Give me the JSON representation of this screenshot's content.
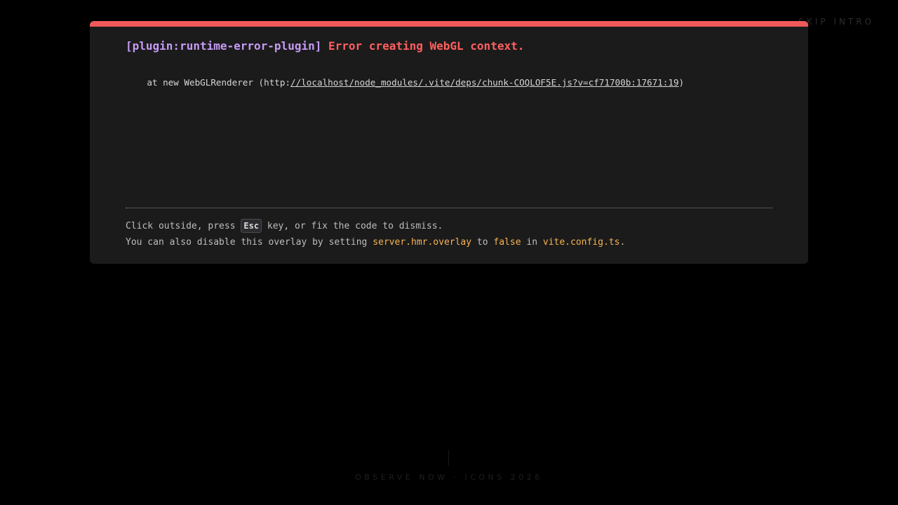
{
  "background": {
    "skip_intro": "SKIP INTRO",
    "footer": "OBSERVE NOW · ICONS 2026"
  },
  "overlay": {
    "accent_color": "#f0595a",
    "plugin": "[plugin:runtime-error-plugin]",
    "message": "Error creating WebGL context.",
    "stack_prefix": "    at new WebGLRenderer (http:",
    "stack_link": "//localhost/node_modules/.vite/deps/chunk-COQLOF5E.js?v=cf71700b:17671:19",
    "stack_suffix": ")",
    "tip_line1_a": "Click outside, press ",
    "tip_key": "Esc",
    "tip_line1_b": " key, or fix the code to dismiss.",
    "tip_line2_a": "You can also disable this overlay by setting ",
    "tip_setting": "server.hmr.overlay",
    "tip_line2_b": " to ",
    "tip_value": "false",
    "tip_line2_c": " in ",
    "tip_file": "vite.config.ts",
    "tip_line2_d": "."
  }
}
